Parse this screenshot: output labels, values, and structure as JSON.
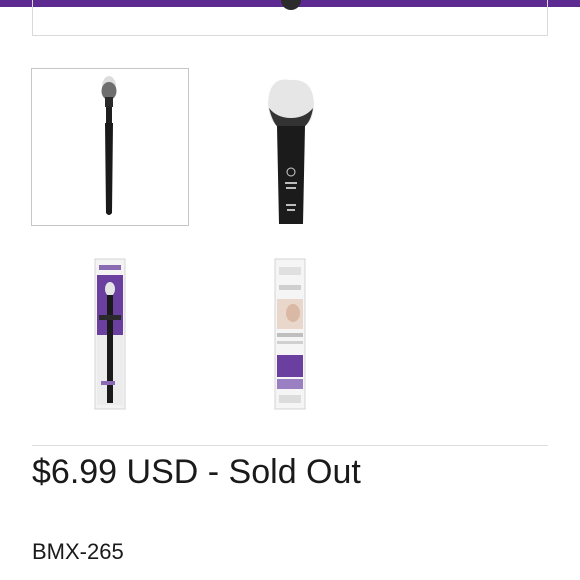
{
  "product": {
    "price": "$6.99 USD",
    "separator": " - ",
    "status": "Sold Out",
    "sku": "BMX-265"
  },
  "thumbnails": [
    {
      "icon": "brush-side-view-image",
      "selected": true
    },
    {
      "icon": "brush-head-closeup-image",
      "selected": false
    },
    {
      "icon": "brush-package-front-image",
      "selected": false
    },
    {
      "icon": "brush-package-back-image",
      "selected": false
    }
  ],
  "colors": {
    "header": "#5c2a91",
    "package_purple": "#6b3fa0",
    "brush_black": "#1c1c1c"
  }
}
